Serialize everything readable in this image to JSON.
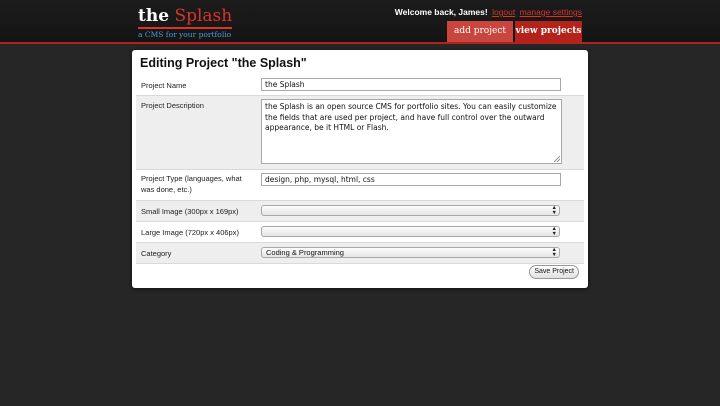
{
  "header": {
    "logo_the": "the",
    "logo_splash": "Splash",
    "tagline": "a CMS for your portfolio",
    "welcome_text": "Welcome back, James!",
    "logout_label": "logout",
    "manage_label": "manage settings",
    "add_project_label": "add project",
    "view_projects_label": "view projects"
  },
  "form": {
    "title": "Editing Project \"the Splash\"",
    "name_label": "Project Name",
    "name_value": "the Splash",
    "description_label": "Project Description",
    "description_value": "the Splash is an open source CMS for portfolio sites. You can easily customize the fields that are used per project, and have full control over the outward appearance, be it HTML or Flash.",
    "type_label": "Project Type (languages, what was done, etc.)",
    "type_value": "design, php, mysql, html, css",
    "small_image_label": "Small Image (300px x 169px)",
    "small_image_value": "",
    "large_image_label": "Large Image (720px x 406px)",
    "large_image_value": "",
    "category_label": "Category",
    "category_value": "Coding & Programming",
    "save_label": "Save Project"
  },
  "colors": {
    "brand_red": "#b3231c",
    "link_blue": "#4d9ad6",
    "background": "#262626"
  }
}
